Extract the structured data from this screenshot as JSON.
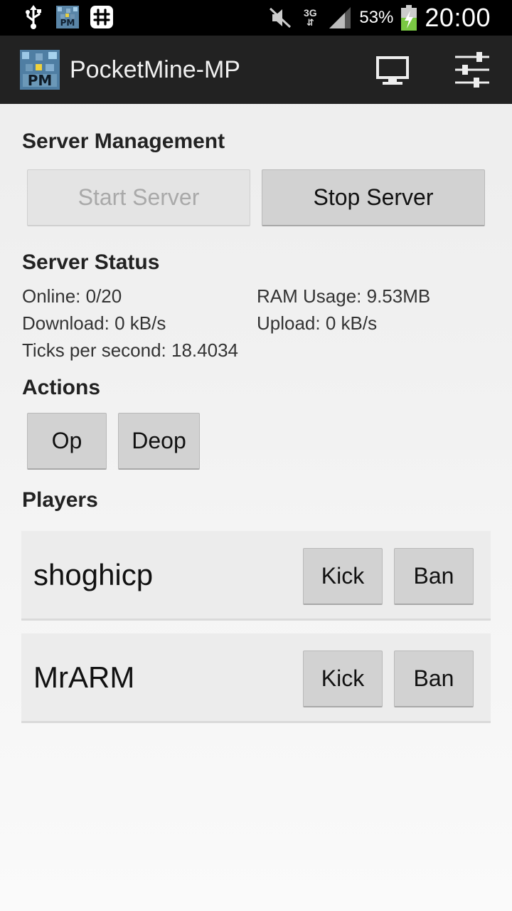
{
  "status_bar": {
    "icons_left": [
      "usb-icon",
      "pocketmine-notification-icon",
      "hash-app-icon"
    ],
    "network_type": "3G",
    "battery_percent": "53%",
    "time": "20:00"
  },
  "action_bar": {
    "title": "PocketMine-MP",
    "icons": [
      "monitor-icon",
      "sliders-icon"
    ]
  },
  "server_management": {
    "title": "Server Management",
    "start_label": "Start Server",
    "stop_label": "Stop Server"
  },
  "server_status": {
    "title": "Server Status",
    "online": "Online: 0/20",
    "ram": "RAM Usage: 9.53MB",
    "download": "Download: 0 kB/s",
    "upload": "Upload: 0 kB/s",
    "tps": "Ticks per second: 18.4034"
  },
  "actions": {
    "title": "Actions",
    "op_label": "Op",
    "deop_label": "Deop"
  },
  "players": {
    "title": "Players",
    "kick_label": "Kick",
    "ban_label": "Ban",
    "list": [
      {
        "name": "shoghicp"
      },
      {
        "name": "MrARM"
      }
    ]
  },
  "colors": {
    "action_bar": "#222222",
    "status_bar": "#000000",
    "button": "#d2d2d2",
    "battery_charge": "#7ac943"
  }
}
